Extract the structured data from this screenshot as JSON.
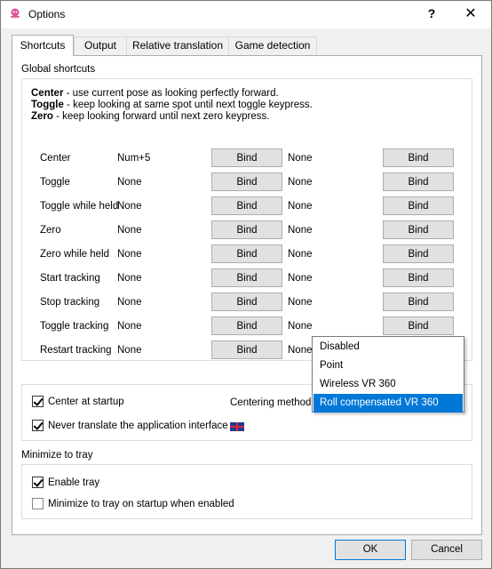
{
  "window": {
    "title": "Options",
    "help": "?",
    "close": "✕"
  },
  "tabs": [
    {
      "label": "Shortcuts",
      "active": true
    },
    {
      "label": "Output"
    },
    {
      "label": "Relative translation"
    },
    {
      "label": "Game detection"
    }
  ],
  "shortcuts": {
    "section_label": "Global shortcuts",
    "help_lines": [
      {
        "key": "Center",
        "text": " - use current pose as looking perfectly forward."
      },
      {
        "key": "Toggle",
        "text": " - keep looking at same spot until next toggle keypress."
      },
      {
        "key": "Zero",
        "text": " - keep looking forward until next zero keypress."
      }
    ],
    "bind_label": "Bind",
    "rows": [
      {
        "name": "Center",
        "key1": "Num+5",
        "key2": "None"
      },
      {
        "name": "Toggle",
        "key1": "None",
        "key2": "None"
      },
      {
        "name": "Toggle while held",
        "key1": "None",
        "key2": "None"
      },
      {
        "name": "Zero",
        "key1": "None",
        "key2": "None"
      },
      {
        "name": "Zero while held",
        "key1": "None",
        "key2": "None"
      },
      {
        "name": "Start tracking",
        "key1": "None",
        "key2": "None"
      },
      {
        "name": "Stop tracking",
        "key1": "None",
        "key2": "None"
      },
      {
        "name": "Toggle tracking",
        "key1": "None",
        "key2": "None"
      },
      {
        "name": "Restart tracking",
        "key1": "None",
        "key2": "None"
      }
    ]
  },
  "startup": {
    "center_at_startup": {
      "label": "Center at startup",
      "checked": true
    },
    "centering_method_label": "Centering method",
    "never_translate": {
      "label": "Never translate the application interface",
      "checked": true
    },
    "flag_icon": "uk-flag-icon"
  },
  "centering_dropdown": {
    "options": [
      "Disabled",
      "Point",
      "Wireless VR 360",
      "Roll compensated VR 360"
    ],
    "selected": "Roll compensated VR 360"
  },
  "tray": {
    "section_label": "Minimize to tray",
    "enable_tray": {
      "label": "Enable tray",
      "checked": true
    },
    "minimize_on_startup": {
      "label": "Minimize to tray on startup when enabled",
      "checked": false
    }
  },
  "buttons": {
    "ok": "OK",
    "cancel": "Cancel"
  },
  "colors": {
    "accent": "#0078d7",
    "window_bg": "#f0f0f0",
    "panel_bg": "#ffffff",
    "flag_blue": "#1f3a93",
    "flag_red": "#d42a3a",
    "icon_pink": "#e0529a"
  }
}
